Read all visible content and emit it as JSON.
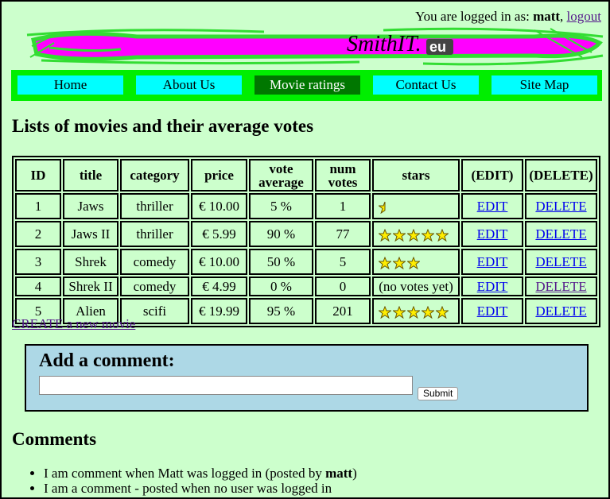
{
  "user": {
    "prefix": "You are logged in as: ",
    "name": "matt",
    "separator": ", ",
    "logout": "logout"
  },
  "brand": {
    "logo_main": "SmithIT.",
    "logo_suffix": "eu",
    "colors": {
      "stroke": "#33dd33",
      "fill": "#ff00ff"
    }
  },
  "nav": {
    "items": [
      "Home",
      "About Us",
      "Movie ratings",
      "Contact Us",
      "Site Map"
    ],
    "active": "Movie ratings"
  },
  "page": {
    "title": "Lists of movies and their average votes"
  },
  "table": {
    "headers": {
      "id": "ID",
      "title": "title",
      "category": "category",
      "price": "price",
      "vote_average": "vote average",
      "num_votes": "num votes",
      "stars": "stars",
      "edit": "(EDIT)",
      "delete": "(DELETE)"
    },
    "rows": [
      {
        "id": "1",
        "title": "Jaws",
        "category": "thriller",
        "price": "€ 10.00",
        "vote_average": "5 %",
        "num_votes": "1",
        "star_rating": 0.5,
        "stars_text": "",
        "edit": "EDIT",
        "delete": "DELETE"
      },
      {
        "id": "2",
        "title": "Jaws II",
        "category": "thriller",
        "price": "€ 5.99",
        "vote_average": "90 %",
        "num_votes": "77",
        "star_rating": 5,
        "stars_text": "",
        "edit": "EDIT",
        "delete": "DELETE"
      },
      {
        "id": "3",
        "title": "Shrek",
        "category": "comedy",
        "price": "€ 10.00",
        "vote_average": "50 %",
        "num_votes": "5",
        "star_rating": 3,
        "stars_text": "",
        "edit": "EDIT",
        "delete": "DELETE"
      },
      {
        "id": "4",
        "title": "Shrek II",
        "category": "comedy",
        "price": "€ 4.99",
        "vote_average": "0 %",
        "num_votes": "0",
        "star_rating": 0,
        "stars_text": "(no votes yet)",
        "edit": "EDIT",
        "delete": "DELETE"
      },
      {
        "id": "5",
        "title": "Alien",
        "category": "scifi",
        "price": "€ 19.99",
        "vote_average": "95 %",
        "num_votes": "201",
        "star_rating": 5,
        "stars_text": "",
        "edit": "EDIT",
        "delete": "DELETE"
      }
    ]
  },
  "create_link": "CREATE a new movie",
  "comment_form": {
    "title": "Add a comment:",
    "input_value": "",
    "submit_label": "Submit",
    "background": "#add8e6"
  },
  "comments": {
    "heading": "Comments",
    "items": [
      {
        "text": "I am comment when Matt was logged in (posted by ",
        "author": "matt",
        "suffix": ")"
      },
      {
        "text": "I am a comment - posted when no user was logged in",
        "author": "",
        "suffix": ""
      }
    ]
  },
  "colors": {
    "page_bg": "#ccffcc",
    "nav_bg": "#00ee00",
    "nav_button": "#00ffff",
    "nav_active": "#007700",
    "link": "#0000ee",
    "visited_link": "#551a8b",
    "star": "#ffee00"
  }
}
